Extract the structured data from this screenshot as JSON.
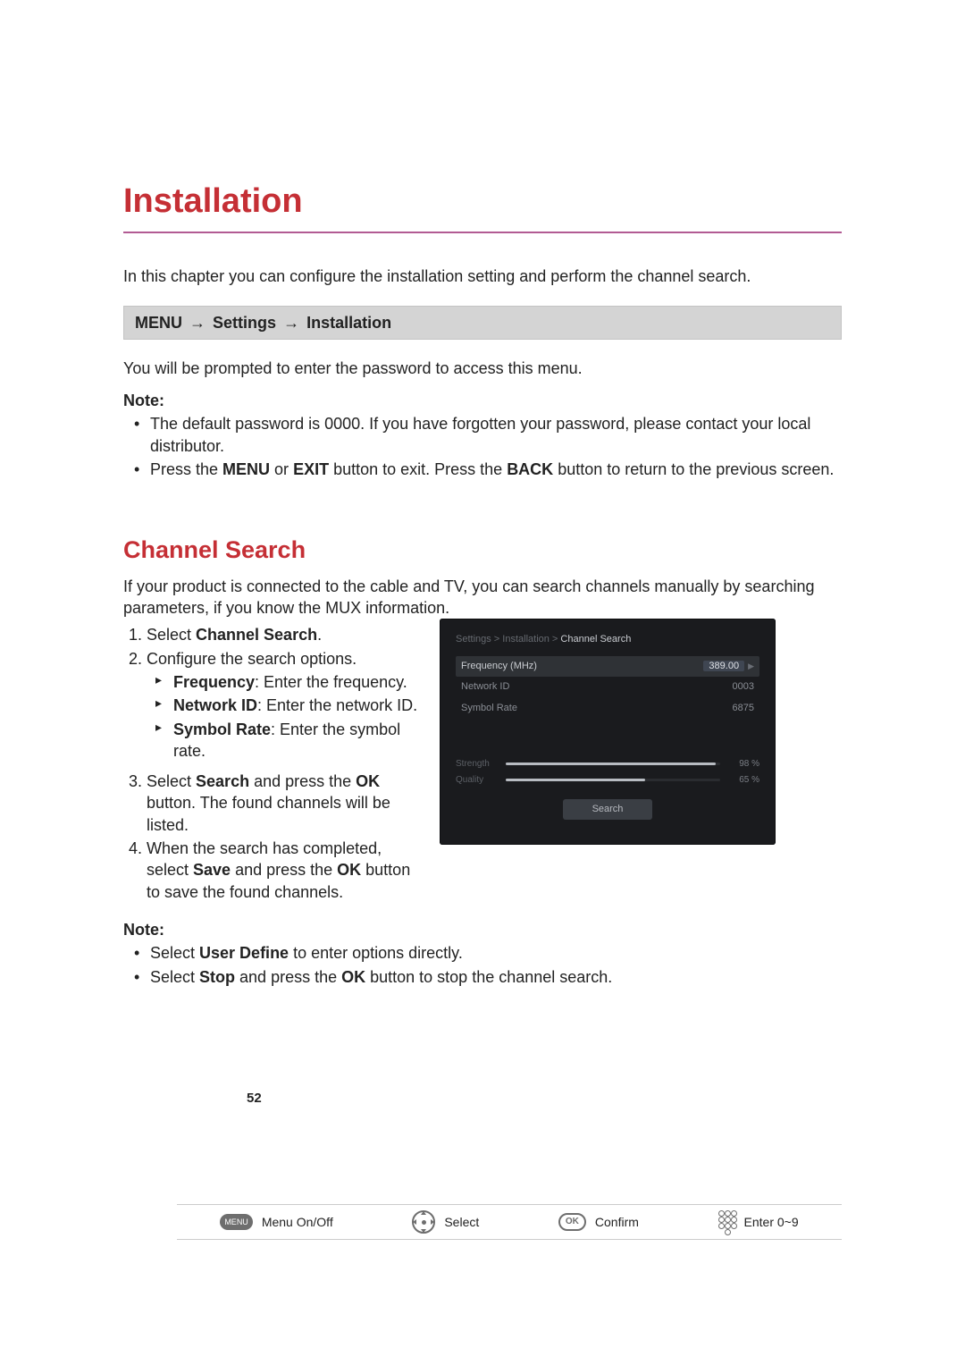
{
  "title": "Installation",
  "intro": "In this chapter you can configure the installation setting and perform the channel search.",
  "menu_path": {
    "menu": "MENU",
    "a1": "→",
    "settings": "Settings",
    "a2": "→",
    "installation": "Installation"
  },
  "prompt_text": "You will be prompted to enter the password to access this menu.",
  "note1": {
    "label": "Note:",
    "bullets": [
      {
        "text": "The default password is 0000. If you have forgotten your password, please contact your local distributor."
      },
      {
        "pre": "Press the ",
        "b1": "MENU",
        "mid": " or ",
        "b2": "EXIT",
        "mid2": " button to exit. Press the ",
        "b3": "BACK",
        "post": " button to return to the previous screen."
      }
    ]
  },
  "section": {
    "title": "Channel Search",
    "intro": "If your product is connected to the cable and TV, you can search channels manually by searching parameters, if you know the MUX information.",
    "steps": {
      "s1": {
        "pre": "Select ",
        "b": "Channel Search",
        "post": "."
      },
      "s2": {
        "text": "Configure the search options.",
        "sub": [
          {
            "b": "Frequency",
            "post": ": Enter the frequency."
          },
          {
            "b": "Network ID",
            "post": ": Enter the network ID."
          },
          {
            "b": "Symbol Rate",
            "post": ": Enter the symbol rate."
          }
        ]
      },
      "s3": {
        "pre": "Select ",
        "b1": "Search",
        "mid": " and press the ",
        "b2": "OK",
        "post": " button. The found channels will be listed."
      },
      "s4": {
        "pre": "When the search has completed, select ",
        "b1": "Save",
        "mid": " and press the ",
        "b2": "OK",
        "post": " button to save the found channels."
      }
    }
  },
  "note2": {
    "label": "Note:",
    "bullets": [
      {
        "pre": "Select ",
        "b": "User Define",
        "post": " to enter options directly."
      },
      {
        "pre": "Select ",
        "b1": "Stop",
        "mid": " and press the ",
        "b2": "OK",
        "post": " button to stop the channel search."
      }
    ]
  },
  "tv": {
    "breadcrumb": {
      "path": "Settings > Installation >",
      "current": "Channel Search"
    },
    "rows": [
      {
        "label": "Frequency (MHz)",
        "value": "389.00",
        "selected": true
      },
      {
        "label": "Network ID",
        "value": "0003",
        "selected": false
      },
      {
        "label": "Symbol Rate",
        "value": "6875",
        "selected": false
      }
    ],
    "meters": [
      {
        "label": "Strength",
        "value": "98 %",
        "pct": 98
      },
      {
        "label": "Quality",
        "value": "65 %",
        "pct": 65
      }
    ],
    "search_button": "Search"
  },
  "legend": {
    "menu_icon": "MENU",
    "menu_text": "Menu On/Off",
    "select_text": "Select",
    "ok_icon": "OK",
    "confirm_text": "Confirm",
    "enter_text": "Enter 0~9"
  },
  "page_number": "52"
}
